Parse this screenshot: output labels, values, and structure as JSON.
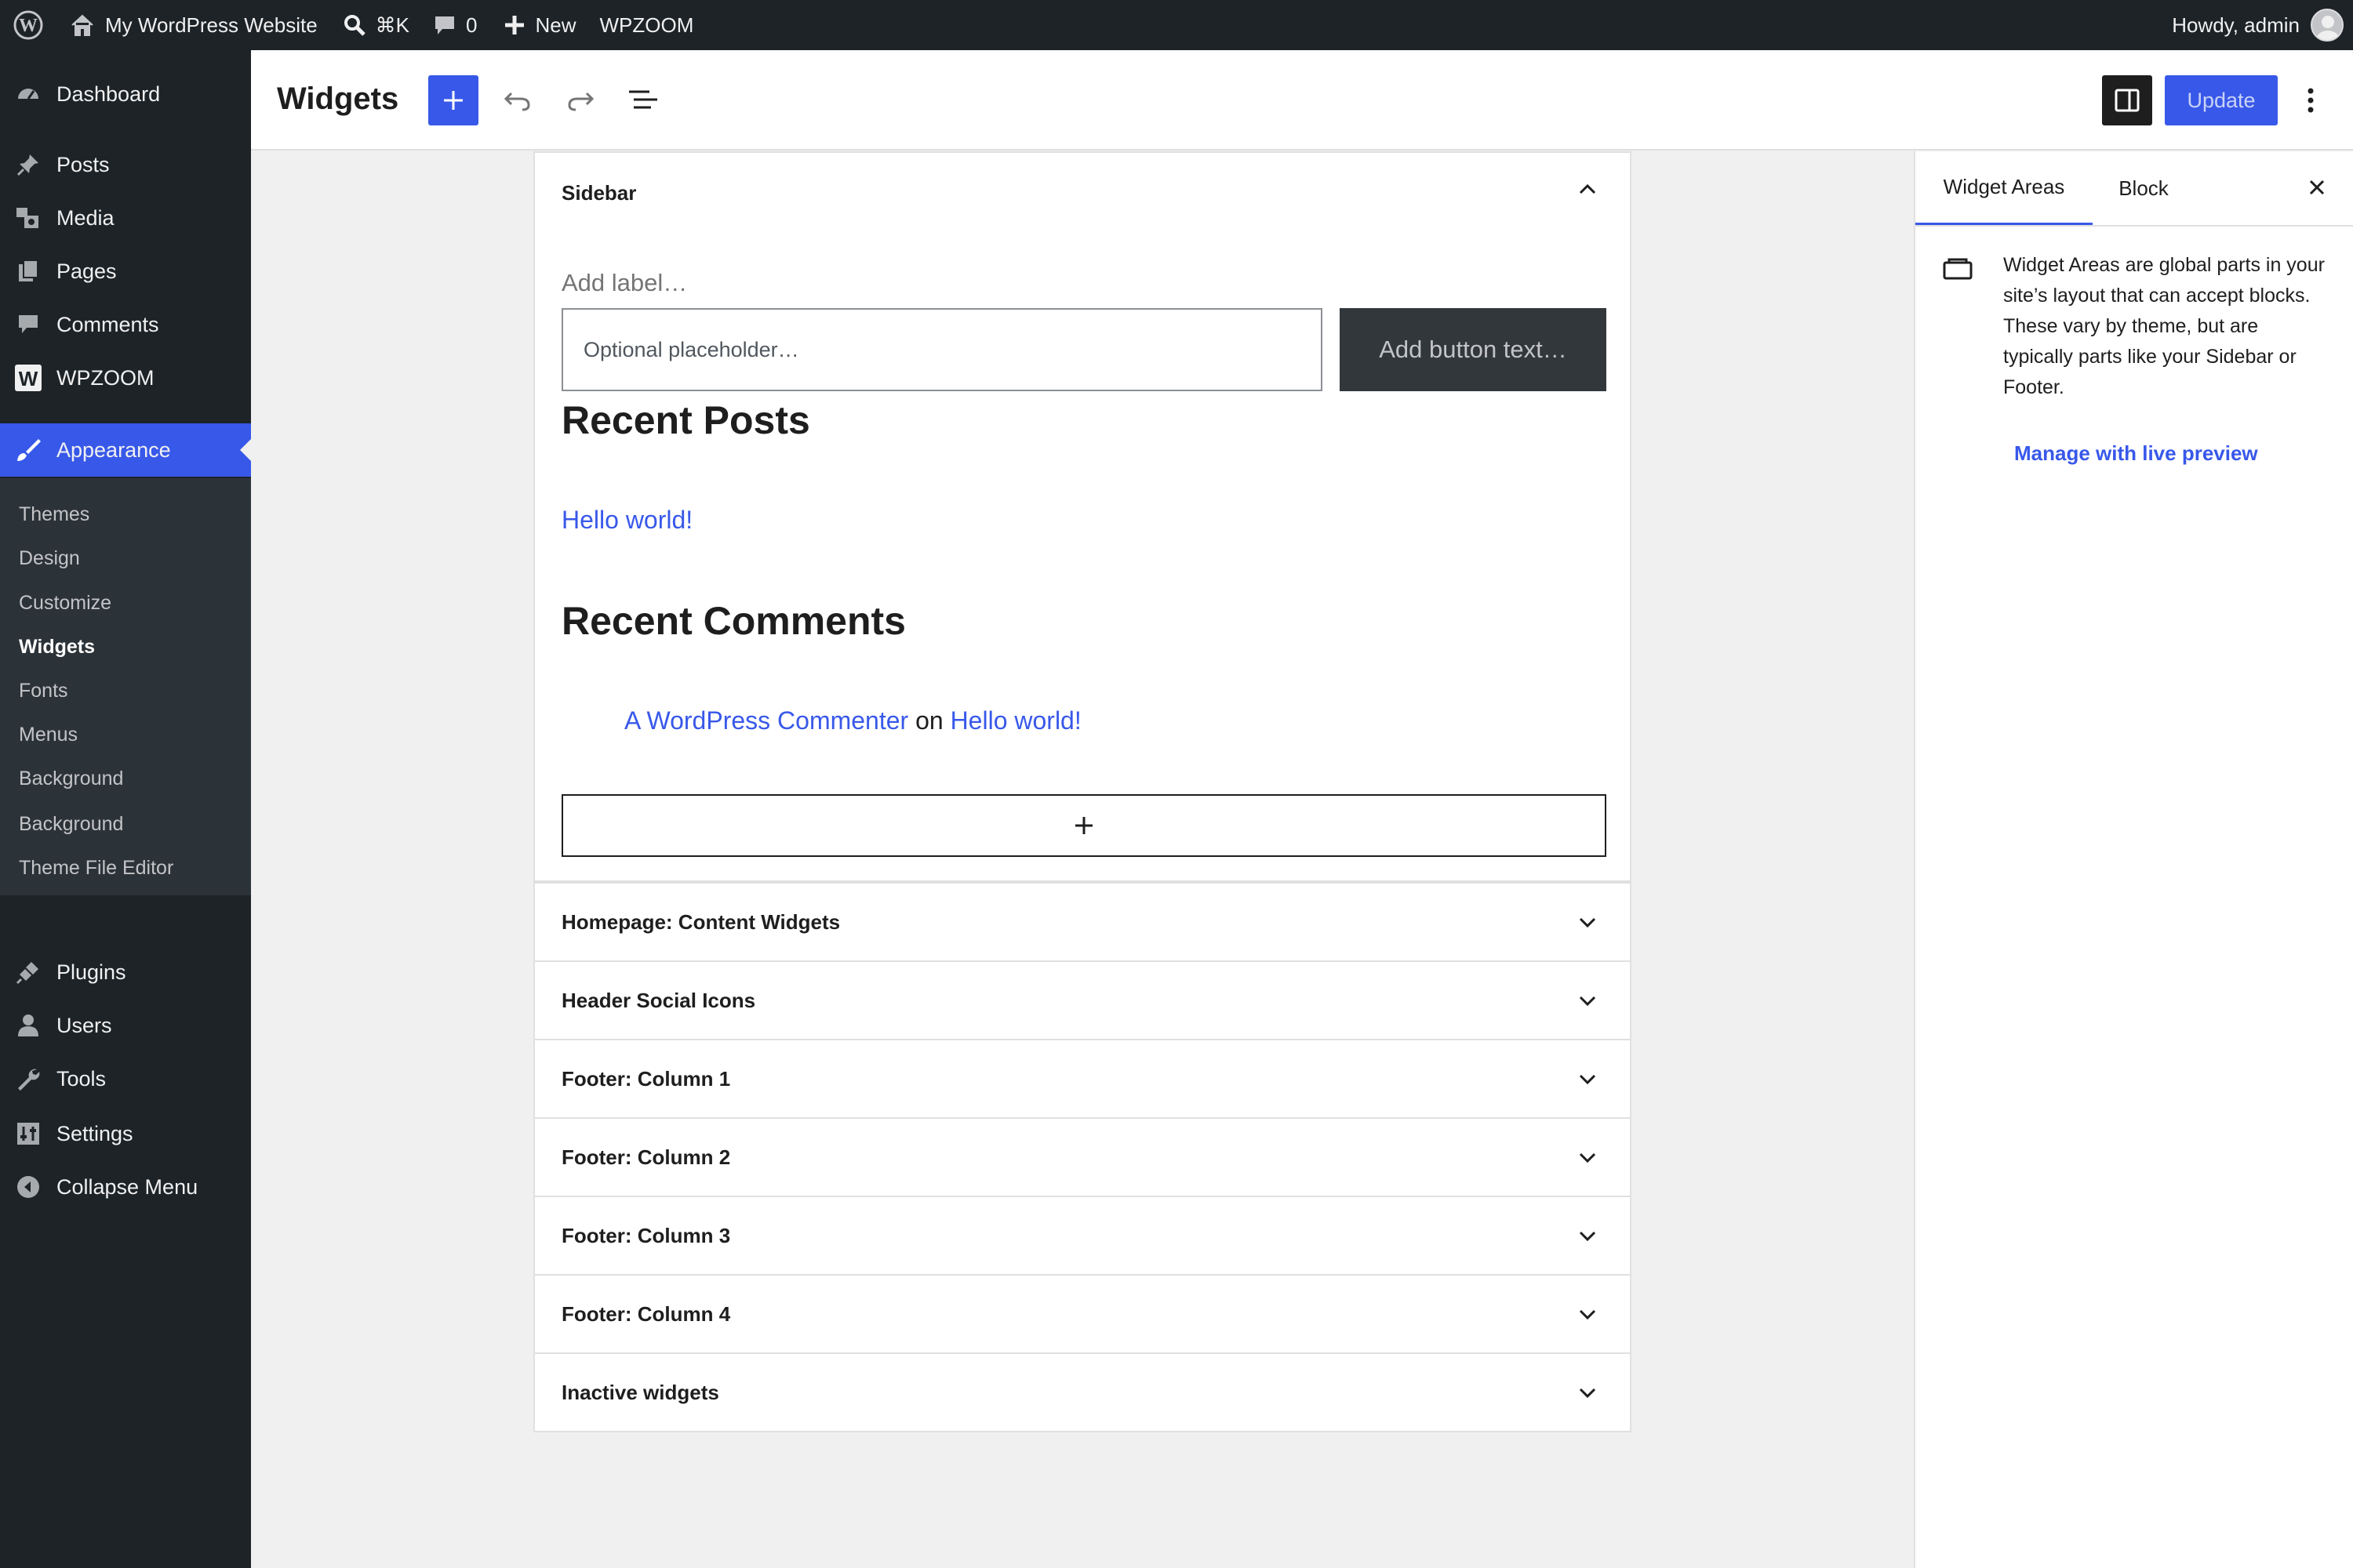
{
  "admin_bar": {
    "site_name": "My WordPress Website",
    "shortcut": "⌘K",
    "comment_count": "0",
    "new_label": "New",
    "theme_item": "WPZOOM",
    "greeting": "Howdy, admin"
  },
  "admin_menu": {
    "items": [
      {
        "label": "Dashboard",
        "icon": "dashboard-icon"
      },
      {
        "label": "Posts",
        "icon": "pin-icon"
      },
      {
        "label": "Media",
        "icon": "media-icon"
      },
      {
        "label": "Pages",
        "icon": "pages-icon"
      },
      {
        "label": "Comments",
        "icon": "comments-icon"
      },
      {
        "label": "WPZOOM",
        "icon": "wpzoom-icon"
      },
      {
        "label": "Appearance",
        "icon": "brush-icon"
      },
      {
        "label": "Plugins",
        "icon": "plugin-icon"
      },
      {
        "label": "Users",
        "icon": "users-icon"
      },
      {
        "label": "Tools",
        "icon": "wrench-icon"
      },
      {
        "label": "Settings",
        "icon": "settings-icon"
      },
      {
        "label": "Collapse Menu",
        "icon": "collapse-icon"
      }
    ],
    "submenu": [
      "Themes",
      "Design",
      "Customize",
      "Widgets",
      "Fonts",
      "Menus",
      "Background",
      "Background",
      "Theme File Editor"
    ],
    "current_submenu": "Widgets"
  },
  "header": {
    "title": "Widgets",
    "update_label": "Update"
  },
  "sidebar_area": {
    "title": "Sidebar",
    "search_label": "Add label…",
    "search_placeholder": "Optional placeholder…",
    "search_button": "Add button text…",
    "recent_posts_heading": "Recent Posts",
    "post_link": "Hello world!",
    "recent_comments_heading": "Recent Comments",
    "comment_author": "A WordPress Commenter",
    "comment_on": "on",
    "comment_post": "Hello world!"
  },
  "collapsed_areas": [
    "Homepage: Content Widgets",
    "Header Social Icons",
    "Footer: Column 1",
    "Footer: Column 2",
    "Footer: Column 3",
    "Footer: Column 4",
    "Inactive widgets"
  ],
  "inspector": {
    "tab_areas": "Widget Areas",
    "tab_block": "Block",
    "description": "Widget Areas are global parts in your site’s layout that can accept blocks. These vary by theme, but are typically parts like your Sidebar or Footer.",
    "live_preview": "Manage with live preview"
  },
  "colors": {
    "accent": "#3858e9",
    "admin_dark": "#1d2327",
    "submenu_bg": "#2c3338"
  }
}
